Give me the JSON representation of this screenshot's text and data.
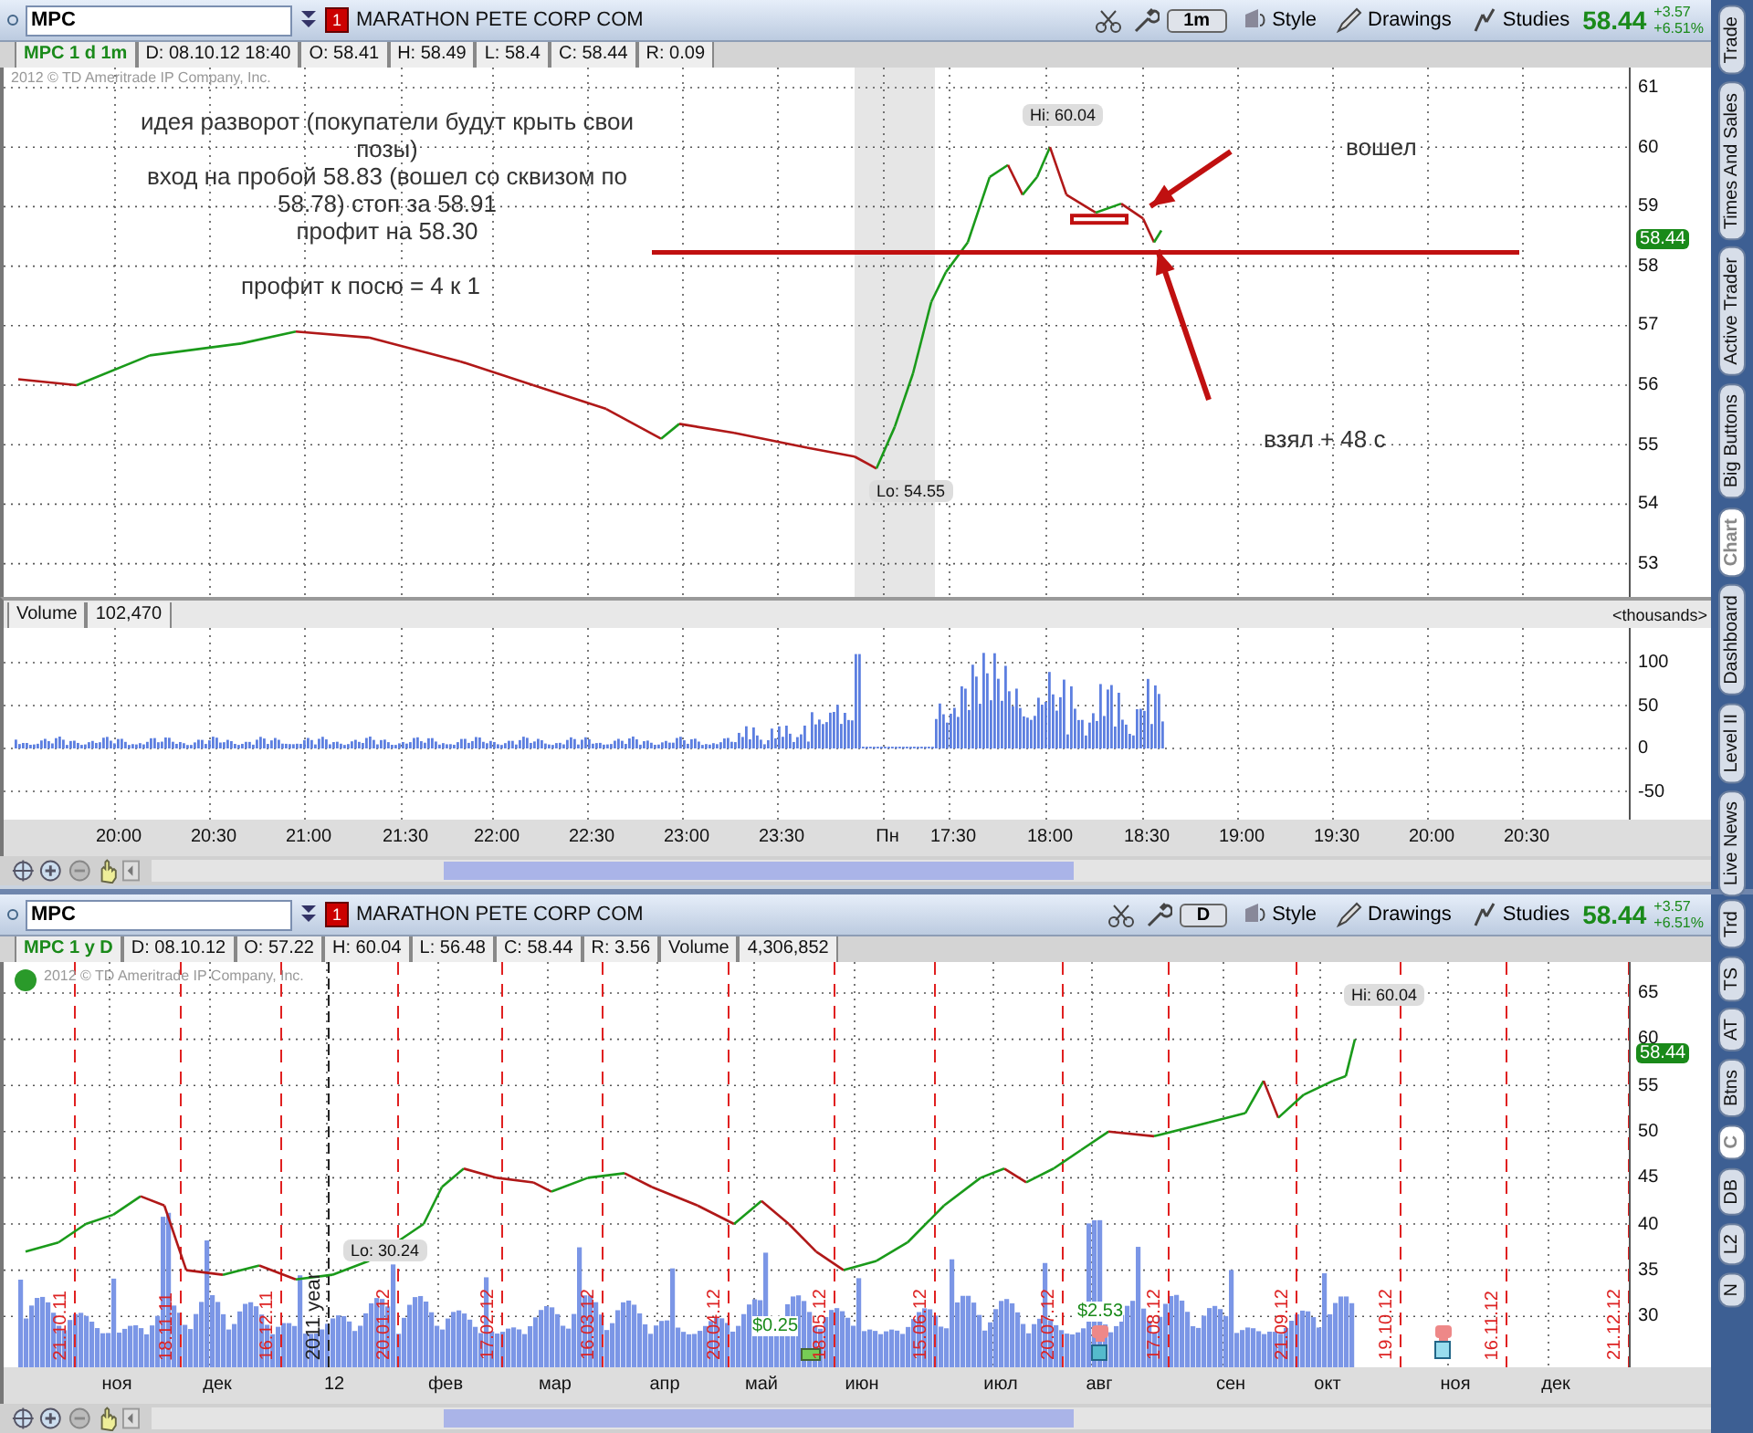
{
  "top_chart": {
    "toolbar": {
      "symbol": "MPC",
      "alert_count": "1",
      "company": "MARATHON PETE CORP COM",
      "aggregation": "1m",
      "buttons": [
        "Style",
        "Drawings",
        "Studies"
      ],
      "last": "58.44",
      "change": "+3.57",
      "change_pct": "+6.51%"
    },
    "info": [
      "MPC 1 d 1m",
      "D: 08.10.12 18:40",
      "O: 58.41",
      "H: 58.49",
      "L: 58.4",
      "C: 58.44",
      "R: 0.09"
    ],
    "copyright": "2012 © TD Ameritrade IP Company, Inc.",
    "price_ticks": [
      "61",
      "60",
      "59",
      "58",
      "57",
      "56",
      "55",
      "54",
      "53"
    ],
    "price_tag": "58.44",
    "hi_label": "Hi: 60.04",
    "lo_label": "Lo: 54.55",
    "idea_note": [
      "идея разворот (покупатели будут крыть свои",
      "позы)",
      "вход на пробой 58.83 (вошел со сквизом по",
      "58.78) стоп за 58.91",
      "профит на 58.30"
    ],
    "ratio_note": "профит к посю = 4 к 1",
    "entry_note": "вошел",
    "exit_note": "взял + 48 с",
    "volume": {
      "label": "Volume",
      "value": "102,470",
      "units": "<thousands>",
      "ticks": [
        "100",
        "50",
        "0",
        "-50"
      ]
    },
    "time_ticks": [
      "20:00",
      "20:30",
      "21:00",
      "21:30",
      "22:00",
      "22:30",
      "23:00",
      "23:30",
      "Пн",
      "17:30",
      "18:00",
      "18:30",
      "19:00",
      "19:30",
      "20:00",
      "20:30"
    ]
  },
  "side_tabs": [
    {
      "label": "Trade",
      "selected": false
    },
    {
      "label": "Times And Sales",
      "selected": false
    },
    {
      "label": "Active Trader",
      "selected": false
    },
    {
      "label": "Big Buttons",
      "selected": false
    },
    {
      "label": "Chart",
      "selected": true
    },
    {
      "label": "Dashboard",
      "selected": false
    },
    {
      "label": "Level II",
      "selected": false
    },
    {
      "label": "Live News",
      "selected": false
    }
  ],
  "bottom_chart": {
    "toolbar": {
      "symbol": "MPC",
      "alert_count": "1",
      "company": "MARATHON PETE CORP COM",
      "aggregation": "D",
      "buttons": [
        "Style",
        "Drawings",
        "Studies"
      ],
      "last": "58.44",
      "change": "+3.57",
      "change_pct": "+6.51%"
    },
    "info": [
      "MPC 1 y D",
      "D: 08.10.12",
      "O: 57.22",
      "H: 60.04",
      "L: 56.48",
      "C: 58.44",
      "R: 3.56",
      "Volume",
      "4,306,852"
    ],
    "copyright": "2012 © TD Ameritrade IP Company, Inc.",
    "price_ticks": [
      "65",
      "60",
      "55",
      "50",
      "45",
      "40",
      "35",
      "30"
    ],
    "price_tag": "58.44",
    "hi_label": "Hi: 60.04",
    "lo_label": "Lo: 30.24",
    "year_marker": "2011 year",
    "expiry_dates": [
      "21.10.11",
      "18.11.11",
      "16.12.11",
      "20.01.12",
      "17.02.12",
      "16.03.12",
      "20.04.12",
      "18.05.12",
      "15.06.12",
      "20.07.12",
      "17.08.12",
      "21.09.12",
      "19.10.12",
      "16.11.12",
      "21.12.12"
    ],
    "dividends": [
      "$0.25",
      "$2.53"
    ],
    "month_ticks": [
      "ноя",
      "дек",
      "12",
      "фев",
      "мар",
      "апр",
      "май",
      "июн",
      "июл",
      "авг",
      "сен",
      "окт",
      "ноя",
      "дек"
    ]
  },
  "bottom_side_tabs": [
    {
      "label": "Trd",
      "selected": false
    },
    {
      "label": "TS",
      "selected": false
    },
    {
      "label": "AT",
      "selected": false
    },
    {
      "label": "Btns",
      "selected": false
    },
    {
      "label": "C",
      "selected": true
    },
    {
      "label": "DB",
      "selected": false
    },
    {
      "label": "L2",
      "selected": false
    },
    {
      "label": "N",
      "selected": false
    }
  ]
}
